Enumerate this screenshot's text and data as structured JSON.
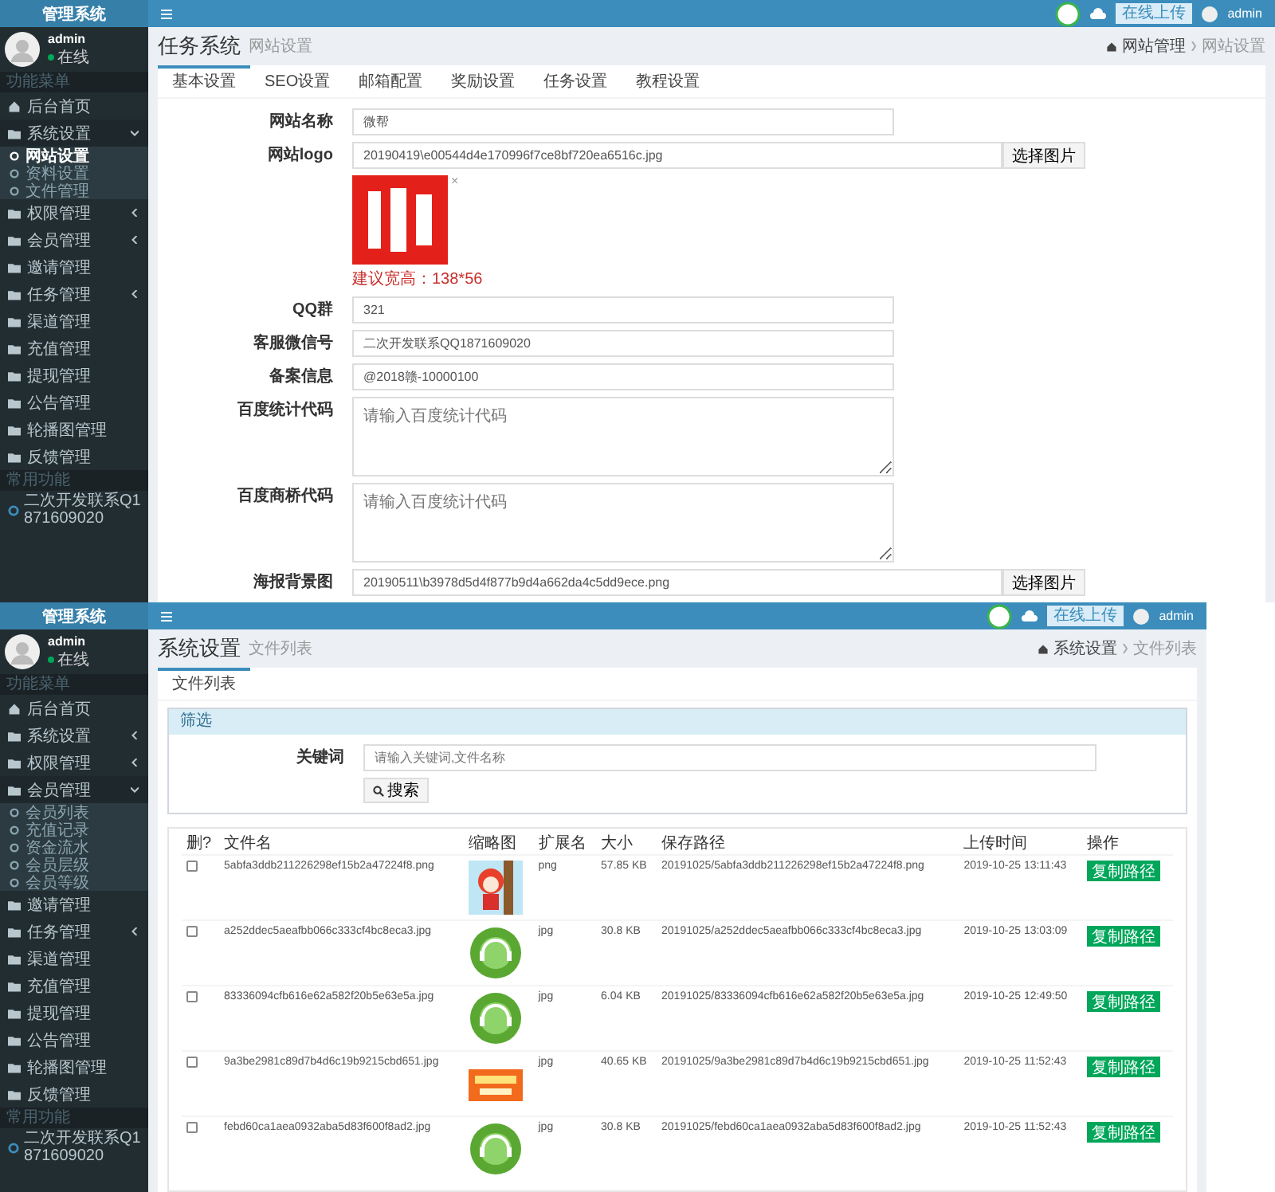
{
  "screens": [
    {
      "brand": "管理系统",
      "user": {
        "name": "admin",
        "status": "在线"
      },
      "menu_title": "功能菜单",
      "menu": [
        {
          "label": "后台首页"
        },
        {
          "label": "系统设置",
          "expanded": true,
          "children": [
            {
              "label": "网站设置",
              "selected": true
            },
            {
              "label": "资料设置",
              "selected": false
            },
            {
              "label": "文件管理",
              "selected": false
            }
          ]
        },
        {
          "label": "权限管理",
          "expanded": false
        },
        {
          "label": "会员管理",
          "expanded": false
        },
        {
          "label": "邀请管理"
        },
        {
          "label": "任务管理",
          "expanded": false
        },
        {
          "label": "渠道管理"
        },
        {
          "label": "充值管理"
        },
        {
          "label": "提现管理"
        },
        {
          "label": "公告管理"
        },
        {
          "label": "轮播图管理"
        },
        {
          "label": "反馈管理"
        }
      ],
      "footer_title": "常用功能",
      "footer_link": "二次开发联系Q1871609020",
      "header": {
        "upload_button": "在线上传",
        "user": "admin"
      },
      "title": "任务系统",
      "subtitle": "网站设置",
      "breadcrumb": [
        "网站管理",
        "网站设置"
      ],
      "tabs": [
        {
          "label": "基本设置",
          "selected": true
        },
        {
          "label": "SEO设置",
          "selected": false
        },
        {
          "label": "邮箱配置",
          "selected": false
        },
        {
          "label": "奖励设置",
          "selected": false
        },
        {
          "label": "任务设置",
          "selected": false
        },
        {
          "label": "教程设置",
          "selected": false
        }
      ],
      "form": [
        {
          "kind": "text",
          "label": "网站名称",
          "value": "微帮"
        },
        {
          "kind": "file",
          "label": "网站logo",
          "value": "20190419\\e00544d4e170996f7ce8bf720ea6516c.jpg",
          "button": "选择图片"
        },
        {
          "close": "×",
          "hint": "建议宽高：138*56"
        },
        {
          "kind": "text",
          "label": "QQ群",
          "value": "321"
        },
        {
          "kind": "text",
          "label": "客服微信号",
          "value": "二次开发联系QQ1871609020"
        },
        {
          "kind": "text",
          "label": "备案信息",
          "value": "@2018赣-10000100"
        },
        {
          "kind": "textarea",
          "label": "百度统计代码",
          "placeholder": "请输入百度统计代码"
        },
        {
          "kind": "textarea",
          "label": "百度商桥代码",
          "placeholder": "请输入百度统计代码"
        },
        {
          "kind": "file",
          "label": "海报背景图",
          "value": "20190511\\b3978d5d4f877b9d4a662da4c5dd9ece.png",
          "button": "选择图片"
        }
      ]
    },
    {
      "brand": "管理系统",
      "user": {
        "name": "admin",
        "status": "在线"
      },
      "menu_title": "功能菜单",
      "menu": [
        {
          "label": "后台首页"
        },
        {
          "label": "系统设置",
          "expanded": false
        },
        {
          "label": "权限管理",
          "expanded": false
        },
        {
          "label": "会员管理",
          "expanded": true,
          "children": [
            {
              "label": "会员列表",
              "selected": false
            },
            {
              "label": "充值记录",
              "selected": false
            },
            {
              "label": "资金流水",
              "selected": false
            },
            {
              "label": "会员层级",
              "selected": false
            },
            {
              "label": "会员等级",
              "selected": false
            }
          ]
        },
        {
          "label": "邀请管理"
        },
        {
          "label": "任务管理",
          "expanded": false
        },
        {
          "label": "渠道管理"
        },
        {
          "label": "充值管理"
        },
        {
          "label": "提现管理"
        },
        {
          "label": "公告管理"
        },
        {
          "label": "轮播图管理"
        },
        {
          "label": "反馈管理"
        }
      ],
      "footer_title": "常用功能",
      "footer_link": "二次开发联系Q1871609020",
      "header": {
        "upload_button": "在线上传",
        "user": "admin"
      },
      "title": "系统设置",
      "subtitle": "文件列表",
      "breadcrumb": [
        "系统设置",
        "文件列表"
      ],
      "tabs": [
        {
          "label": "文件列表",
          "selected": true
        }
      ],
      "filter": {
        "title": "筛选",
        "label": "关键词",
        "placeholder": "请输入关键词,文件名称",
        "button": "搜索"
      },
      "table": {
        "columns": [
          "删?",
          "文件名",
          "缩略图",
          "扩展名",
          "大小",
          "保存路径",
          "上传时间",
          "操作"
        ],
        "rows": [
          {
            "checked": false,
            "name": "5abfa3ddb211226298ef15b2a47224f8.png",
            "ext": "png",
            "size": "57.85 KB",
            "path": "20191025/5abfa3ddb211226298ef15b2a47224f8.png",
            "time": "2019-10-25 13:11:43",
            "action": "复制路径"
          },
          {
            "checked": false,
            "name": "a252ddec5aeafbb066c333cf4bc8eca3.jpg",
            "ext": "jpg",
            "size": "30.8 KB",
            "path": "20191025/a252ddec5aeafbb066c333cf4bc8eca3.jpg",
            "time": "2019-10-25 13:03:09",
            "action": "复制路径"
          },
          {
            "checked": false,
            "name": "83336094cfb616e62a582f20b5e63e5a.jpg",
            "ext": "jpg",
            "size": "6.04 KB",
            "path": "20191025/83336094cfb616e62a582f20b5e63e5a.jpg",
            "time": "2019-10-25 12:49:50",
            "action": "复制路径"
          },
          {
            "checked": false,
            "name": "9a3be2981c89d7b4d6c19b9215cbd651.jpg",
            "ext": "jpg",
            "size": "40.65 KB",
            "path": "20191025/9a3be2981c89d7b4d6c19b9215cbd651.jpg",
            "time": "2019-10-25 11:52:43",
            "action": "复制路径"
          },
          {
            "checked": false,
            "name": "febd60ca1aea0932aba5d83f600f8ad2.jpg",
            "ext": "jpg",
            "size": "30.8 KB",
            "path": "20191025/febd60ca1aea0932aba5d83f600f8ad2.jpg",
            "time": "2019-10-25 11:52:43",
            "action": "复制路径"
          }
        ]
      }
    }
  ]
}
